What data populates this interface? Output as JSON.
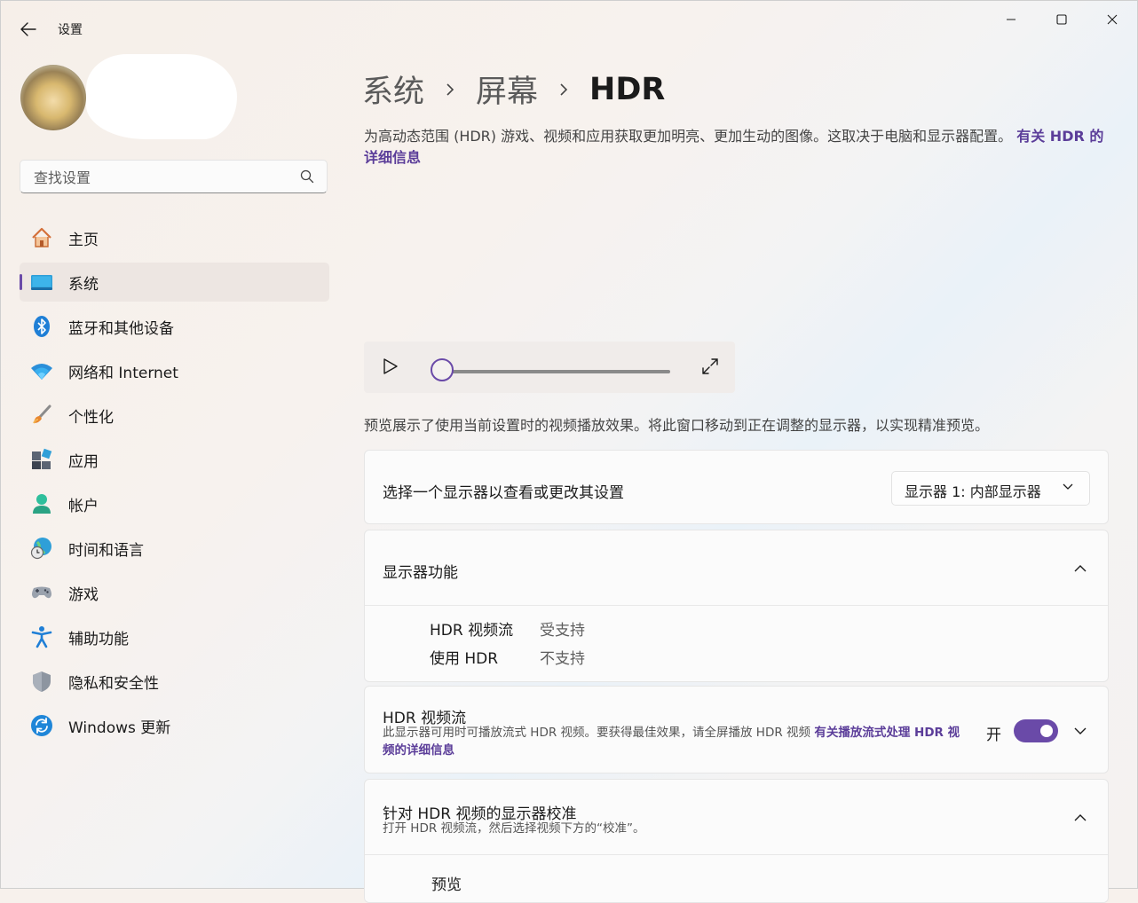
{
  "window": {
    "title": "设置",
    "controls": [
      "minimize-icon",
      "maximize-icon",
      "close-icon"
    ]
  },
  "search": {
    "placeholder": "查找设置"
  },
  "sidebar": {
    "items": [
      {
        "label": "主页",
        "icon": "home-icon"
      },
      {
        "label": "系统",
        "icon": "system-icon",
        "active": true
      },
      {
        "label": "蓝牙和其他设备",
        "icon": "bluetooth-icon"
      },
      {
        "label": "网络和 Internet",
        "icon": "wifi-icon"
      },
      {
        "label": "个性化",
        "icon": "brush-icon"
      },
      {
        "label": "应用",
        "icon": "apps-icon"
      },
      {
        "label": "帐户",
        "icon": "account-icon"
      },
      {
        "label": "时间和语言",
        "icon": "globe-clock-icon"
      },
      {
        "label": "游戏",
        "icon": "gamepad-icon"
      },
      {
        "label": "辅助功能",
        "icon": "accessibility-icon"
      },
      {
        "label": "隐私和安全性",
        "icon": "shield-icon"
      },
      {
        "label": "Windows 更新",
        "icon": "update-icon"
      }
    ]
  },
  "breadcrumb": {
    "items": [
      "系统",
      "屏幕",
      "HDR"
    ]
  },
  "description": {
    "text": "为高动态范围 (HDR) 游戏、视频和应用获取更加明亮、更加生动的图像。这取决于电脑和显示器配置。",
    "link": "有关 HDR 的详细信息"
  },
  "player": {
    "progress": 0
  },
  "preview_note": "预览展示了使用当前设置时的视频播放效果。将此窗口移动到正在调整的显示器，以实现精准预览。",
  "display_select": {
    "label": "选择一个显示器以查看或更改其设置",
    "value": "显示器 1: 内部显示器"
  },
  "capabilities": {
    "title": "显示器功能",
    "rows": [
      {
        "key": "HDR 视频流",
        "value": "受支持"
      },
      {
        "key": "使用 HDR",
        "value": "不支持"
      }
    ]
  },
  "hdr_stream": {
    "title": "HDR 视频流",
    "subtitle": "此显示器可用时可播放流式 HDR 视频。要获得最佳效果，请全屏播放 HDR 视频",
    "link": "有关播放流式处理 HDR 视频的详细信息",
    "state_label": "开",
    "on": true
  },
  "calibration": {
    "title": "针对 HDR 视频的显示器校准",
    "subtitle": "打开 HDR 视频流，然后选择视频下方的“校准”。",
    "preview_label": "预览"
  },
  "colors": {
    "accent": "#6a4aa8"
  }
}
